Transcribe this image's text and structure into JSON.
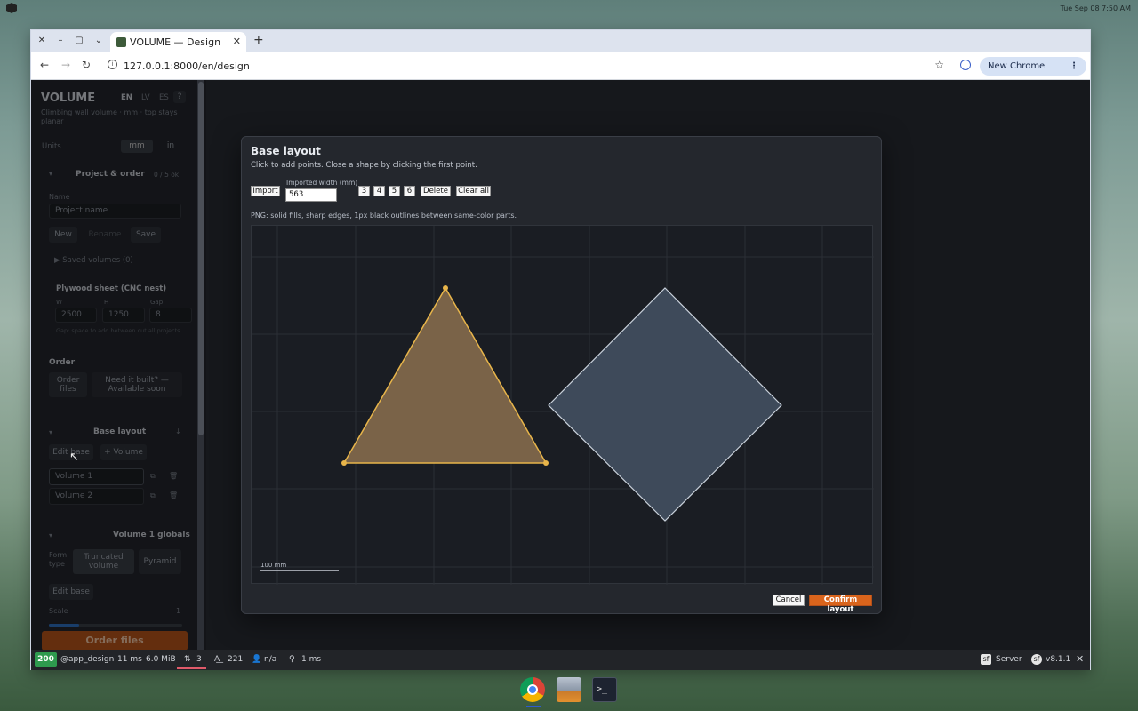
{
  "os": {
    "clock": "Tue Sep 08    7:50 AM"
  },
  "browser": {
    "tab_title": "VOLUME — Design",
    "url": "127.0.0.1:8000/en/design",
    "update_label": "New Chrome available"
  },
  "sidebar": {
    "app_title": "VOLUME",
    "lang": [
      "EN",
      "LV",
      "ES",
      "?"
    ],
    "subtitle": "Climbing wall volume · mm · top stays planar",
    "units_label": "Units",
    "units": [
      "mm",
      "in"
    ],
    "project_section": "Project & order",
    "project_hint": "0 / 5 ok",
    "name_label": "Name",
    "name_placeholder": "Project name",
    "project_buttons": [
      "New",
      "Rename",
      "Save"
    ],
    "saved_volumes": "▶  Saved volumes (0)",
    "plywood_title": "Plywood sheet (CNC nest)",
    "plywood_labels": [
      "W",
      "H",
      "Gap"
    ],
    "plywood_values": [
      "2500",
      "1250",
      "8"
    ],
    "plywood_hint": "Gap: space to add between cut all projects",
    "order_label": "Order",
    "order_files": "Order files",
    "need_built": "Need it built? — Available soon",
    "base_section": "Base layout",
    "edit_base": "Edit base",
    "add_volume": "+ Volume",
    "volumes": [
      "Volume 1",
      "Volume 2"
    ],
    "globals_section": "Volume 1 globals",
    "form_type_label": "Form type",
    "form_types": [
      "Truncated volume",
      "Pyramid"
    ],
    "edit_base_2": "Edit base",
    "scale_label": "Scale",
    "scale_value": "1",
    "order_cta": "Order files"
  },
  "modal": {
    "title": "Base layout",
    "help": "Click to add points. Close a shape by clicking the first point.",
    "import_label": "Import",
    "width_label": "Imported width (mm)",
    "width_value": "563",
    "sides": [
      "3",
      "4",
      "5",
      "6"
    ],
    "delete_label": "Delete",
    "clear_label": "Clear all",
    "png_hint": "PNG: solid fills, sharp edges, 1px black outlines between same-color parts.",
    "scale_bar_label": "100 mm",
    "cancel_label": "Cancel",
    "confirm_label": "Confirm layout",
    "shape_colors": {
      "triangle_fill": "#7a6348",
      "triangle_stroke": "#e8b54a",
      "diamond_fill": "#3e4a5a",
      "diamond_stroke": "#c8d0da"
    }
  },
  "statusbar": {
    "code": "200",
    "route": "@app_design",
    "time": "11 ms",
    "memory": "6.0 MiB",
    "requests": "3",
    "translations": "221",
    "user": "n/a",
    "twig": "1 ms",
    "server_label": "Server",
    "version": "v8.1.1"
  }
}
